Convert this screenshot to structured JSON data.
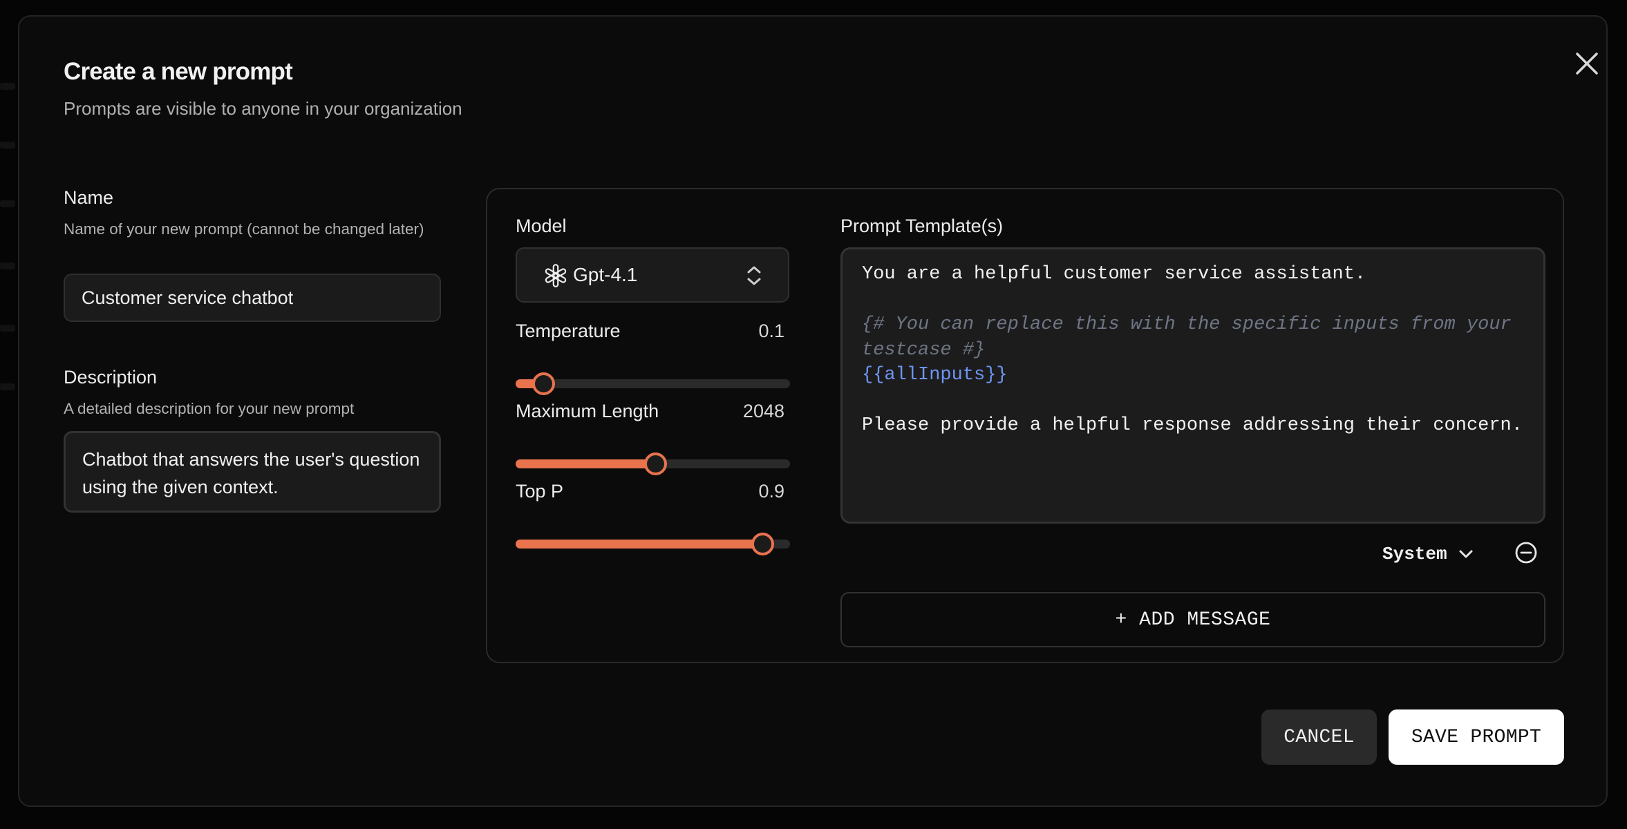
{
  "modal": {
    "title": "Create a new prompt",
    "subtitle": "Prompts are visible to anyone in your organization"
  },
  "name_field": {
    "label": "Name",
    "help": "Name of your new prompt (cannot be changed later)",
    "value": "Customer service chatbot"
  },
  "description_field": {
    "label": "Description",
    "help": "A detailed description for your new prompt",
    "value": "Chatbot that answers the user's question using the given context."
  },
  "model": {
    "label": "Model",
    "selected": "Gpt-4.1",
    "icon": "openai-logo-icon"
  },
  "parameters": {
    "temperature": {
      "label": "Temperature",
      "value": "0.1",
      "fraction": 0.1
    },
    "max_length": {
      "label": "Maximum Length",
      "value": "2048",
      "fraction": 0.51
    },
    "top_p": {
      "label": "Top P",
      "value": "0.9",
      "fraction": 0.9
    }
  },
  "template": {
    "label": "Prompt Template(s)",
    "line1": "You are a helpful customer service assistant.",
    "comment": "{# You can replace this with the specific inputs from your testcase #}",
    "variable": "{{allInputs}}",
    "line4": "Please provide a helpful response addressing their concern.",
    "role": "System"
  },
  "actions": {
    "add_message": "+ ADD MESSAGE",
    "cancel": "CANCEL",
    "save": "SAVE PROMPT"
  },
  "colors": {
    "accent": "#e8734d",
    "variable": "#6e94f4",
    "comment": "#6e7585"
  }
}
